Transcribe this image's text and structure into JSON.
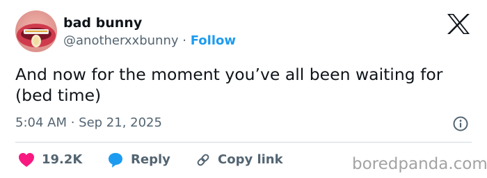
{
  "user": {
    "display_name": "bad bunny",
    "handle": "@anotherxxbunny",
    "separator": "·",
    "follow_label": "Follow"
  },
  "platform_icon": "x-logo-icon",
  "tweet": {
    "text": "And now for the moment you’ve all been waiting for (bed time)",
    "timestamp": "5:04 AM · Sep 21, 2025"
  },
  "actions": {
    "likes_count": "19.2K",
    "reply_label": "Reply",
    "copy_link_label": "Copy link"
  },
  "watermark": "boredpanda.com",
  "colors": {
    "text": "#0f1419",
    "secondary": "#536471",
    "accent": "#1d9bf0",
    "like": "#f91880",
    "divider": "#cfd9de"
  }
}
